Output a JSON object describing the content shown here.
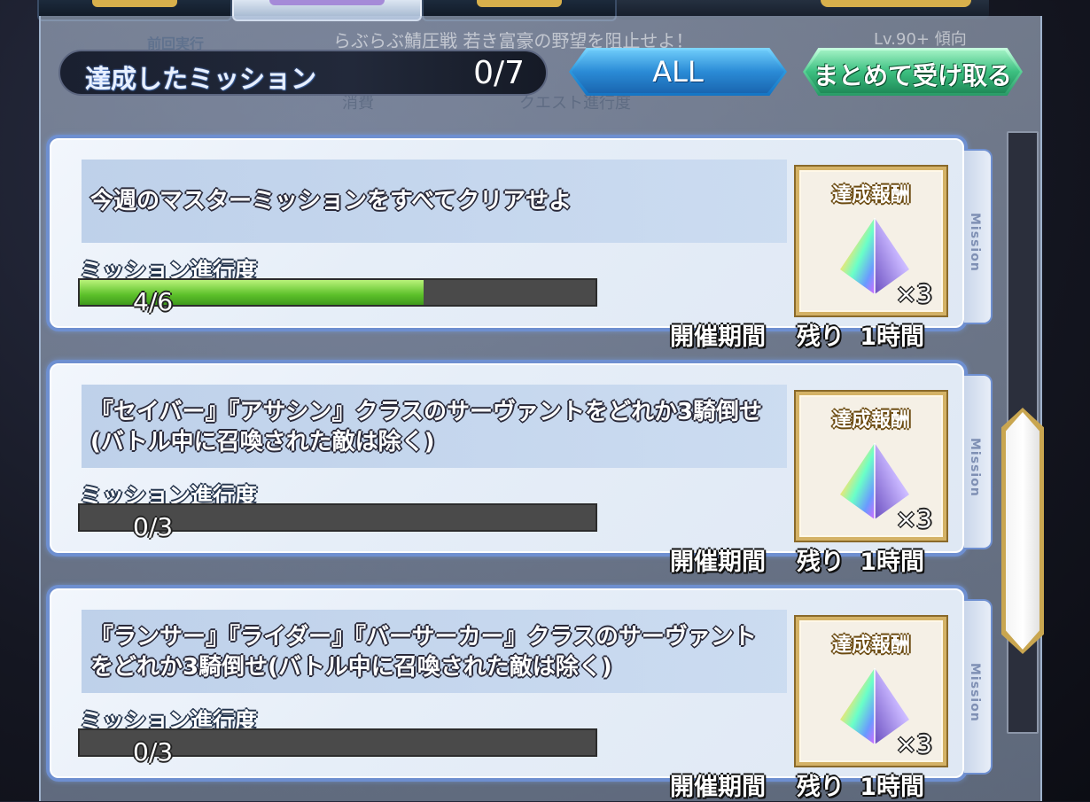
{
  "background": {
    "prev_label": "前回実行",
    "event_text": "らぶらぶ鯖圧戦 若き富豪の野望を阻止せよ！",
    "quest_text": "クエスト進行度",
    "consume_text": "消費",
    "lv_text": "Lv.90+ 傾向"
  },
  "header": {
    "title": "達成したミッション",
    "count": "0/7"
  },
  "buttons": {
    "all_label": "ALL",
    "claim_all_label": "まとめて受け取る"
  },
  "missions": [
    {
      "description": "今週のマスターミッションをすべてクリアせよ",
      "progress_label": "ミッション進行度",
      "progress_text": "4/6",
      "progress_fraction": 0.667,
      "reward_label": "達成報酬",
      "reward_qty": "×3",
      "reward_icon": "saint-quartz-icon",
      "period_label": "開催期間",
      "remaining": "残り 1時間",
      "side_label": "Mission"
    },
    {
      "description": "『セイバー』『アサシン』クラスのサーヴァントをどれか3騎倒せ(バトル中に召喚された敵は除く)",
      "progress_label": "ミッション進行度",
      "progress_text": "0/3",
      "progress_fraction": 0,
      "reward_label": "達成報酬",
      "reward_qty": "×3",
      "reward_icon": "saint-quartz-icon",
      "period_label": "開催期間",
      "remaining": "残り 1時間",
      "side_label": "Mission"
    },
    {
      "description": "『ランサー』『ライダー』『バーサーカー』クラスのサーヴァントをどれか3騎倒せ(バトル中に召喚された敵は除く)",
      "progress_label": "ミッション進行度",
      "progress_text": "0/3",
      "progress_fraction": 0,
      "reward_label": "達成報酬",
      "reward_qty": "×3",
      "reward_icon": "saint-quartz-icon",
      "period_label": "開催期間",
      "remaining": "残り 1時間",
      "side_label": "Mission"
    }
  ],
  "colors": {
    "progress_fill": "#5cc02a",
    "card_border": "#6e8fd0",
    "reward_border": "#d4b266"
  }
}
